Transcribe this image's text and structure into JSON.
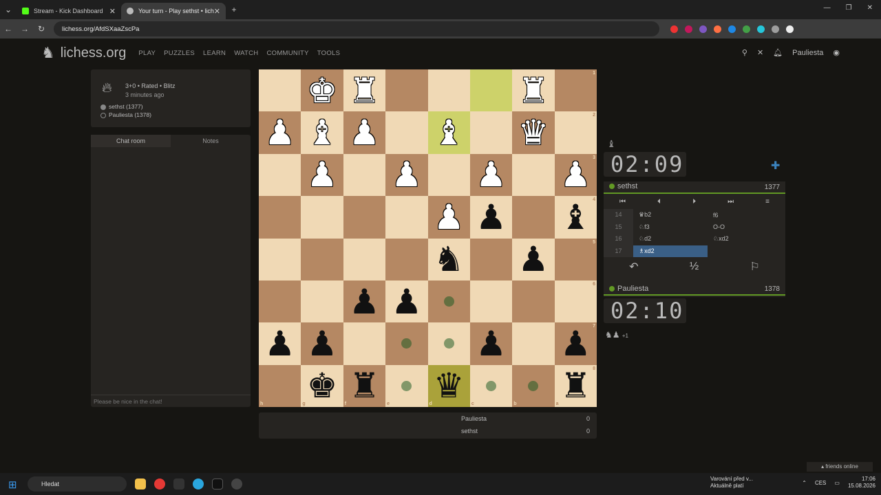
{
  "tabs": [
    {
      "title": "Stream - Kick Dashboard",
      "color": "#53fc18"
    },
    {
      "title": "Your turn - Play sethst • lich",
      "color": "#bababa"
    }
  ],
  "address": {
    "url": "lichess.org/AfdSXaaZscPa"
  },
  "site": {
    "logo": "lichess.org",
    "nav": [
      "PLAY",
      "PUZZLES",
      "LEARN",
      "WATCH",
      "COMMUNITY",
      "TOOLS"
    ],
    "username": "Pauliesta"
  },
  "game": {
    "meta": "3+0 • Rated • Blitz",
    "time_ago": "3 minutes ago",
    "players": [
      "sethst (1377)",
      "Pauliesta (1378)"
    ]
  },
  "chat": {
    "tabs": [
      "Chat room",
      "Notes"
    ],
    "placeholder": "Please be nice in the chat!"
  },
  "board": {
    "ranks": [
      "1",
      "2",
      "3",
      "4",
      "5",
      "6",
      "7",
      "8"
    ],
    "files": [
      "h",
      "g",
      "f",
      "e",
      "d",
      "c",
      "b",
      "a"
    ],
    "rows": [
      [
        "",
        "wK",
        "wR",
        "",
        "",
        "",
        "wR",
        ""
      ],
      [
        "wP",
        "wB",
        "wP",
        "",
        "wB",
        "",
        "wQ",
        ""
      ],
      [
        "",
        "wP",
        "",
        "wP",
        "",
        "wP",
        "",
        "wP"
      ],
      [
        "",
        "",
        "",
        "",
        "wP",
        "bP",
        "",
        "bB"
      ],
      [
        "",
        "",
        "",
        "",
        "bN",
        "",
        "bP",
        ""
      ],
      [
        "",
        "",
        "bP",
        "bP",
        "",
        "",
        "",
        ""
      ],
      [
        "bP",
        "bP",
        "",
        "",
        "",
        "bP",
        "",
        "bP"
      ],
      [
        "",
        "bK",
        "bR",
        "",
        "bQ",
        "",
        "",
        "bR"
      ]
    ]
  },
  "scores": [
    {
      "name": "Pauliesta",
      "score": "0"
    },
    {
      "name": "sethst",
      "score": "0"
    }
  ],
  "opponent": {
    "name": "sethst",
    "rating": "1377",
    "clock": "02:09"
  },
  "me": {
    "name": "Pauliesta",
    "rating": "1378",
    "clock": "02:10"
  },
  "moves": [
    {
      "n": "14",
      "w": "♛b2",
      "b": "f6"
    },
    {
      "n": "15",
      "w": "♘f3",
      "b": "O-O"
    },
    {
      "n": "16",
      "w": "♘d2",
      "b": "♘xd2"
    },
    {
      "n": "17",
      "w": "♗xd2",
      "b": ""
    }
  ],
  "captured": "+1",
  "friends": "friends online",
  "taskbar": {
    "search": "Hledat",
    "warning": "Varování před v...",
    "warning2": "Aktuálně platí",
    "lang": "CES",
    "time": "17:06",
    "date": "15.08.2026"
  }
}
